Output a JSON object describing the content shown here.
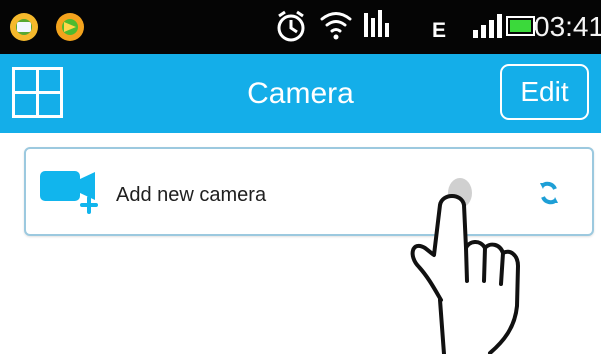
{
  "status_bar": {
    "network_label": "E",
    "time": "03:41"
  },
  "app_bar": {
    "title": "Camera",
    "edit_label": "Edit"
  },
  "camera_list": {
    "add_label": "Add new camera"
  },
  "colors": {
    "app_bar": "#14aee9",
    "card_border": "#9cc9df",
    "camera_icon": "#11b5ed"
  },
  "icons": {
    "left_status": [
      "message-icon",
      "app-icon"
    ],
    "right_status": [
      "alarm-icon",
      "wifi-icon",
      "data-icon",
      "network-type-icon",
      "signal-icon",
      "battery-icon"
    ]
  }
}
